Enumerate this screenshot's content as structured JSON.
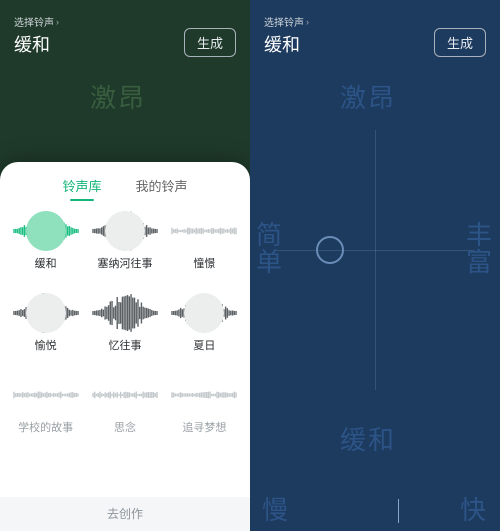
{
  "header": {
    "breadcrumb": "选择铃声",
    "title": "缓和",
    "generate": "生成"
  },
  "left": {
    "bg_word": "激昂"
  },
  "right": {
    "bg_top": "激昂",
    "bg_left": "简\n单",
    "bg_right": "丰\n富",
    "bg_mid": "缓和",
    "bg_bl": "慢",
    "bg_br": "快"
  },
  "sheet": {
    "tab_library": "铃声库",
    "tab_mine": "我的铃声",
    "items": [
      {
        "label": "缓和",
        "style": "dense-green",
        "circle": true,
        "sel": true
      },
      {
        "label": "塞纳河往事",
        "style": "dense-gray",
        "circle": true
      },
      {
        "label": "憧憬",
        "style": "sparse-light",
        "circle": false
      },
      {
        "label": "愉悦",
        "style": "dense-gray",
        "circle": true
      },
      {
        "label": "忆往事",
        "style": "dense-gray",
        "circle": false
      },
      {
        "label": "夏日",
        "style": "dense-gray",
        "circle": true
      },
      {
        "label": "学校的故事",
        "style": "sparse-light",
        "circle": false,
        "dim": true
      },
      {
        "label": "思念",
        "style": "sparse-light",
        "circle": false,
        "dim": true
      },
      {
        "label": "追寻梦想",
        "style": "sparse-light",
        "circle": false,
        "dim": true
      }
    ],
    "create": "去创作"
  }
}
